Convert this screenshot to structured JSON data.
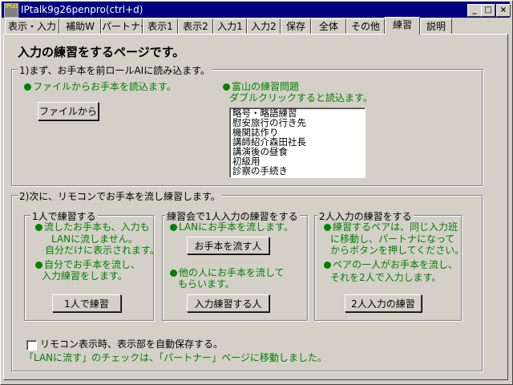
{
  "window": {
    "title": "IPtalk9g26penpro(ctrl+d)",
    "icon_text": "IPtalk"
  },
  "tabs": [
    "表示・入力",
    "補助W",
    "パートナー",
    "表示1",
    "表示2",
    "入力1",
    "入力2",
    "保存",
    "全体",
    "その他",
    "練習",
    "説明"
  ],
  "page_title": "入力の練習をするページです。",
  "section1": {
    "legend": "1)まず、お手本を前ロールAIに読み込ます。",
    "file_note": "ファイルからお手本を読込ます。",
    "file_button": "ファイルから",
    "toyama_title": "富山の練習問題",
    "toyama_sub": "ダブルクリックすると読込ます。",
    "list_items": [
      "略号・略語練習",
      "慰安旅行の行き先",
      "機関誌作り",
      "講師紹介森田社長",
      "講演後の昼食",
      "初級用",
      "診察の手続き"
    ]
  },
  "section2": {
    "legend": "2)次に、リモコンでお手本を流し練習します。",
    "solo": {
      "legend": "1人で練習する",
      "note1_line1": "流したお手本も、入力も",
      "note1_line2": "LANに流しません。",
      "note1_line3": "自分だけに表示されます。",
      "note2_line1": "自分でお手本を流し、",
      "note2_line2": "入力練習をします。",
      "button": "1人で練習"
    },
    "group": {
      "legend": "練習会で1人入力の練習をする",
      "note1": "LANにお手本を流します。",
      "button1": "お手本を流す人",
      "note2_line1": "他の人にお手本を流して",
      "note2_line2": "もらいます。",
      "button2": "入力練習する人"
    },
    "pair": {
      "legend": "2人入力の練習をする",
      "note1_line1": "練習するペアは、同じ入力班",
      "note1_line2": "に移動し、パートナになって",
      "note1_line3": "からボタンを押してください。",
      "note2_line1": "ペアの一人がお手本を流し、",
      "note2_line2": "それを2人で入力します。",
      "button": "2人入力の練習"
    }
  },
  "autosave_label": "リモコン表示時、表示部を自動保存する。",
  "lan_note": "「LANに流す」のチェックは、「パートナー」ページに移動しました。",
  "colors": {
    "accent_green": "#008000",
    "titlebar": "#000080"
  }
}
